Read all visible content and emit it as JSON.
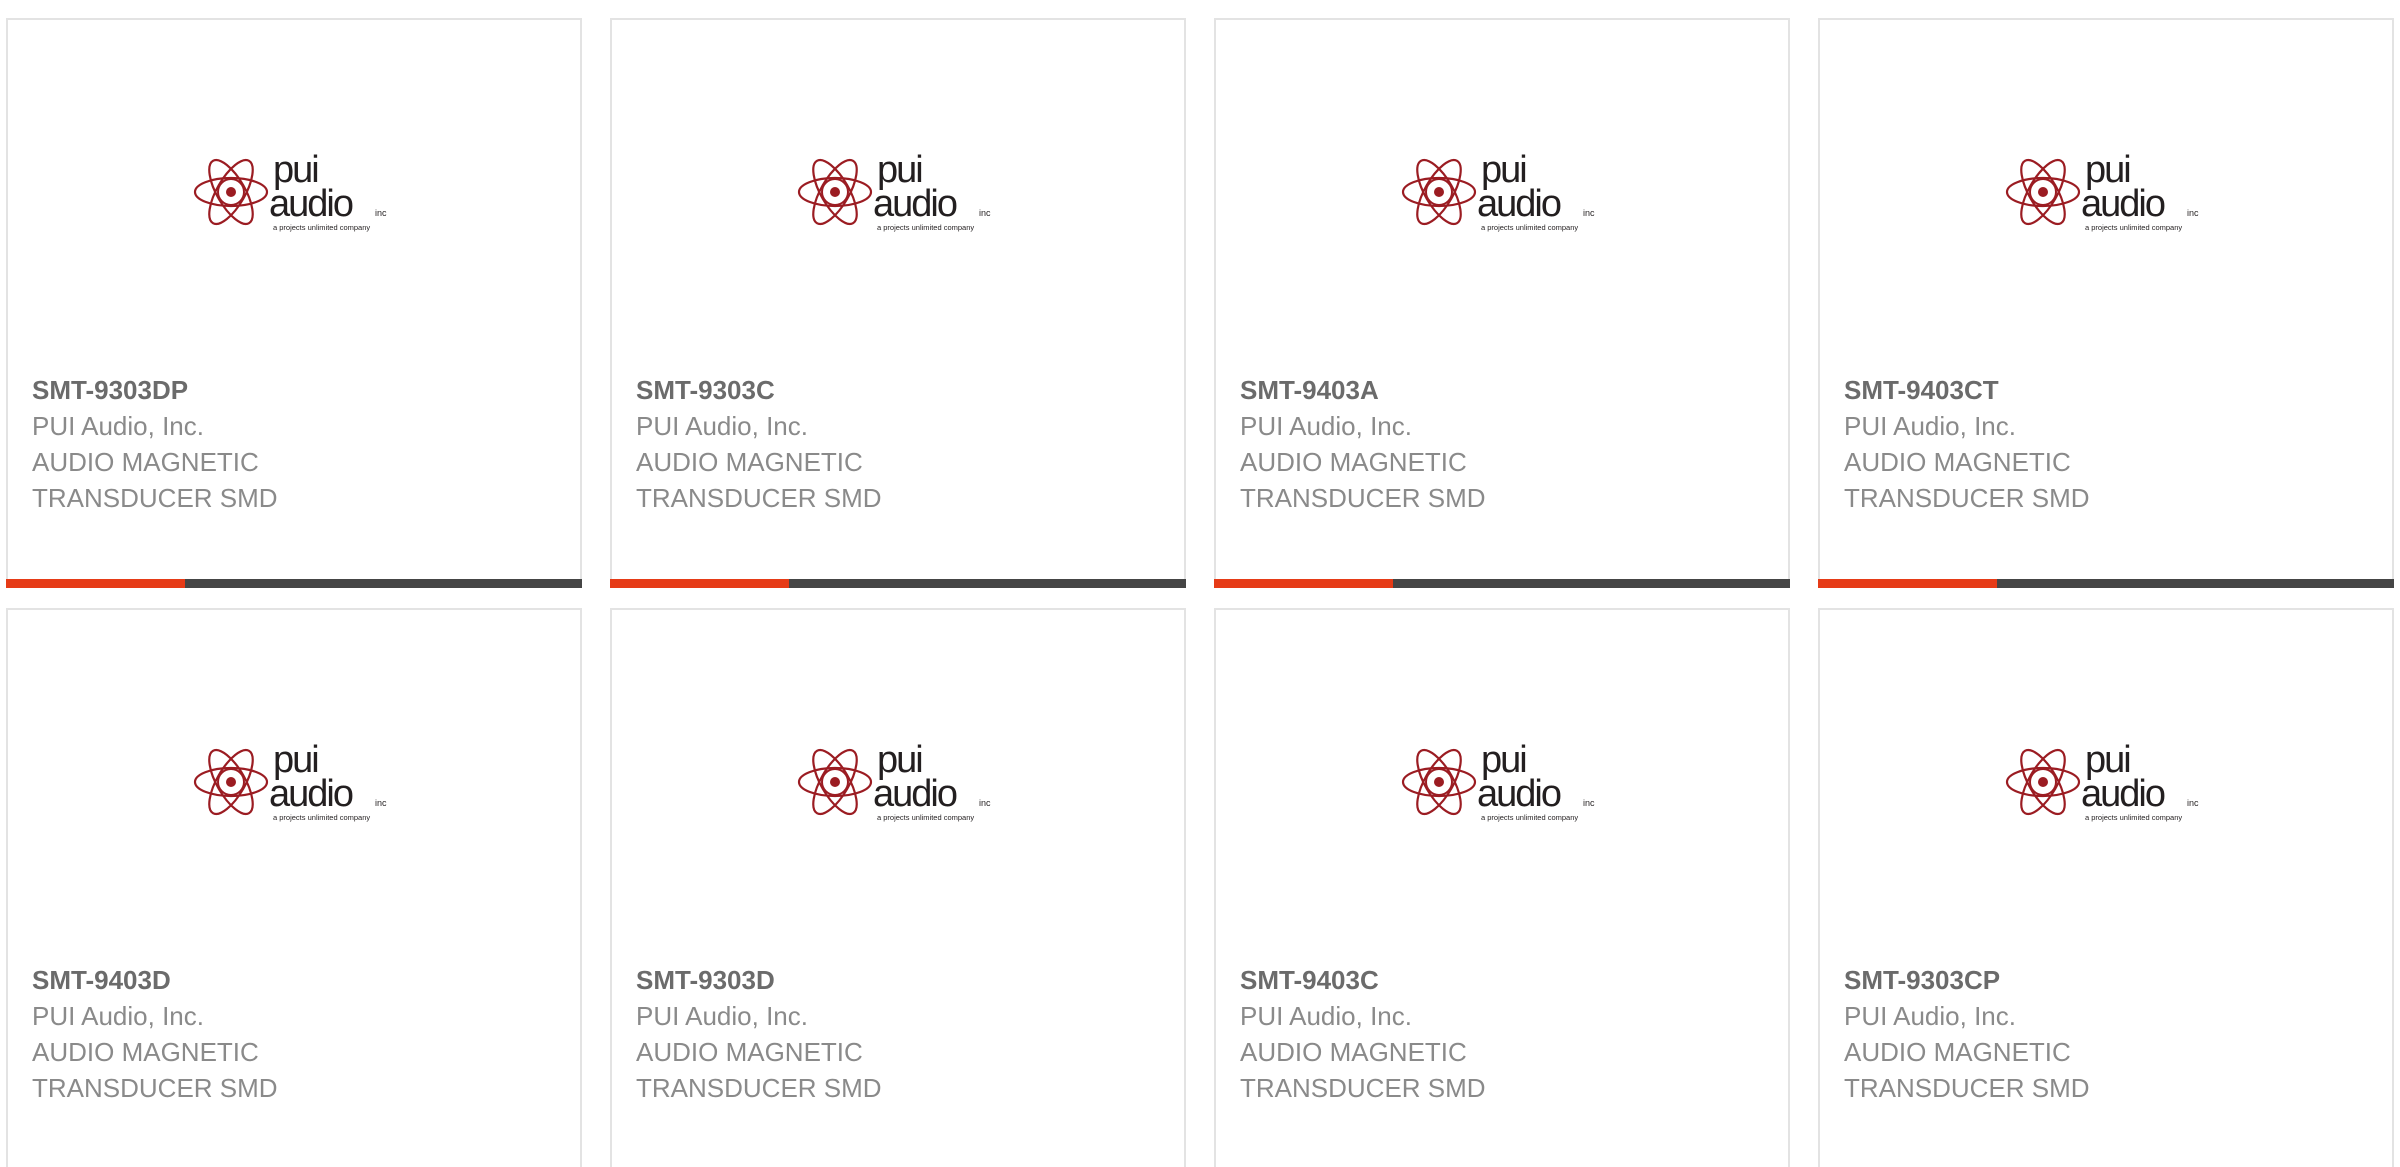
{
  "colors": {
    "progress_fill": "#e63b17",
    "progress_track": "#454545",
    "logo_red": "#9b1c22",
    "logo_text": "#231f20"
  },
  "logo": {
    "icon": "pui-audio-logo-icon",
    "word1": "pui",
    "word2": "audio",
    "suffix": "inc",
    "tagline": "a projects unlimited company"
  },
  "products": [
    {
      "part": "SMT-9303DP",
      "manufacturer": "PUI Audio, Inc.",
      "description": "AUDIO MAGNETIC TRANSDUCER SMD",
      "progress_fraction": 0.31
    },
    {
      "part": "SMT-9303C",
      "manufacturer": "PUI Audio, Inc.",
      "description": "AUDIO MAGNETIC TRANSDUCER SMD",
      "progress_fraction": 0.31
    },
    {
      "part": "SMT-9403A",
      "manufacturer": "PUI Audio, Inc.",
      "description": "AUDIO MAGNETIC TRANSDUCER SMD",
      "progress_fraction": 0.31
    },
    {
      "part": "SMT-9403CT",
      "manufacturer": "PUI Audio, Inc.",
      "description": "AUDIO MAGNETIC TRANSDUCER SMD",
      "progress_fraction": 0.31
    },
    {
      "part": "SMT-9403D",
      "manufacturer": "PUI Audio, Inc.",
      "description": "AUDIO MAGNETIC TRANSDUCER SMD"
    },
    {
      "part": "SMT-9303D",
      "manufacturer": "PUI Audio, Inc.",
      "description": "AUDIO MAGNETIC TRANSDUCER SMD"
    },
    {
      "part": "SMT-9403C",
      "manufacturer": "PUI Audio, Inc.",
      "description": "AUDIO MAGNETIC TRANSDUCER SMD"
    },
    {
      "part": "SMT-9303CP",
      "manufacturer": "PUI Audio, Inc.",
      "description": "AUDIO MAGNETIC TRANSDUCER SMD"
    }
  ]
}
